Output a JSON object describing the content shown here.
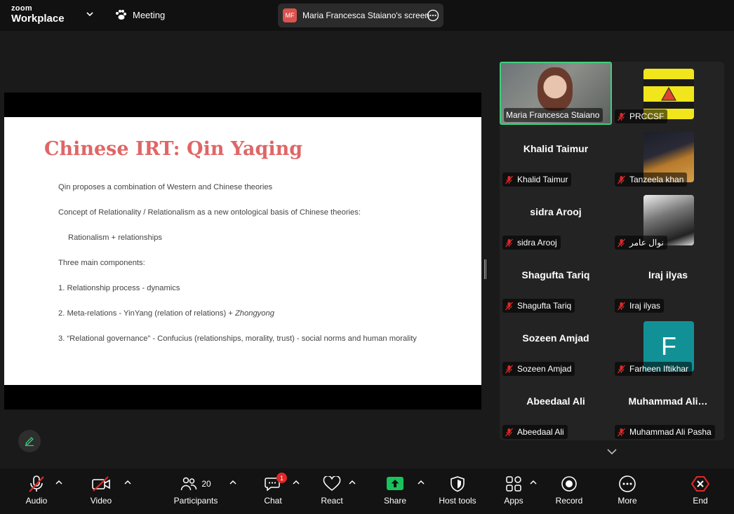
{
  "app": {
    "logo_line1": "zoom",
    "logo_line2": "Workplace",
    "meeting_label": "Meeting"
  },
  "share_indicator": {
    "initials": "MF",
    "text": "Maria Francesca Staiano's screen"
  },
  "slide": {
    "title": "Chinese IRT: Qin Yaqing",
    "lines": [
      "Qin proposes a combination of Western and Chinese theories",
      "Concept of Relationality / Relationalism as a new ontological basis of Chinese theories:",
      "Rationalism + relationships",
      "Three main components:",
      "1. Relationship process - dynamics",
      "2. Meta-relations - YinYang (relation of relations) + ",
      "3. “Relational governance” - Confucius (relationships, morality, trust) - social norms and human morality"
    ],
    "line6_italic": "Zhongyong"
  },
  "participants": [
    {
      "name": "Maria Francesca Staiano",
      "label": "Maria Francesca Staiano",
      "muted": false,
      "tile": "video"
    },
    {
      "name": "PRCCSF",
      "label": "PRCCSF",
      "muted": true,
      "tile": "logo"
    },
    {
      "name": "Khalid Taimur",
      "label": "Khalid Taimur",
      "muted": true,
      "tile": "name"
    },
    {
      "name": "Tanzeela khan",
      "label": "Tanzeela khan",
      "muted": true,
      "tile": "photo"
    },
    {
      "name": "sidra Arooj",
      "label": "sidra Arooj",
      "muted": true,
      "tile": "name"
    },
    {
      "name": "نوال عامر",
      "label": "نوال عامر",
      "muted": true,
      "tile": "photo-bw"
    },
    {
      "name": "Shagufta Tariq",
      "label": "Shagufta Tariq",
      "muted": true,
      "tile": "name"
    },
    {
      "name": "Iraj ilyas",
      "label": "Iraj ilyas",
      "muted": true,
      "tile": "name"
    },
    {
      "name": "Sozeen Amjad",
      "label": "Sozeen Amjad",
      "muted": true,
      "tile": "name"
    },
    {
      "name": "Farheen Iftikhar",
      "label": "Farheen Iftikhar",
      "muted": true,
      "tile": "avatar-F"
    },
    {
      "name": "Abeedaal Ali",
      "label": "Abeedaal Ali",
      "muted": true,
      "tile": "name"
    },
    {
      "name": "Muhammad  Ali…",
      "label": "Muhammad Ali Pasha",
      "muted": true,
      "tile": "name"
    }
  ],
  "avatar_letter": "F",
  "toolbar": {
    "audio": "Audio",
    "video": "Video",
    "participants": "Participants",
    "participants_count": "20",
    "chat": "Chat",
    "chat_badge": "1",
    "react": "React",
    "share": "Share",
    "host_tools": "Host tools",
    "apps": "Apps",
    "record": "Record",
    "more": "More",
    "end": "End"
  },
  "colors": {
    "accent_green": "#3fcf7d",
    "share_green": "#19c35b",
    "end_red": "#e02828",
    "slide_title": "#e06666"
  }
}
